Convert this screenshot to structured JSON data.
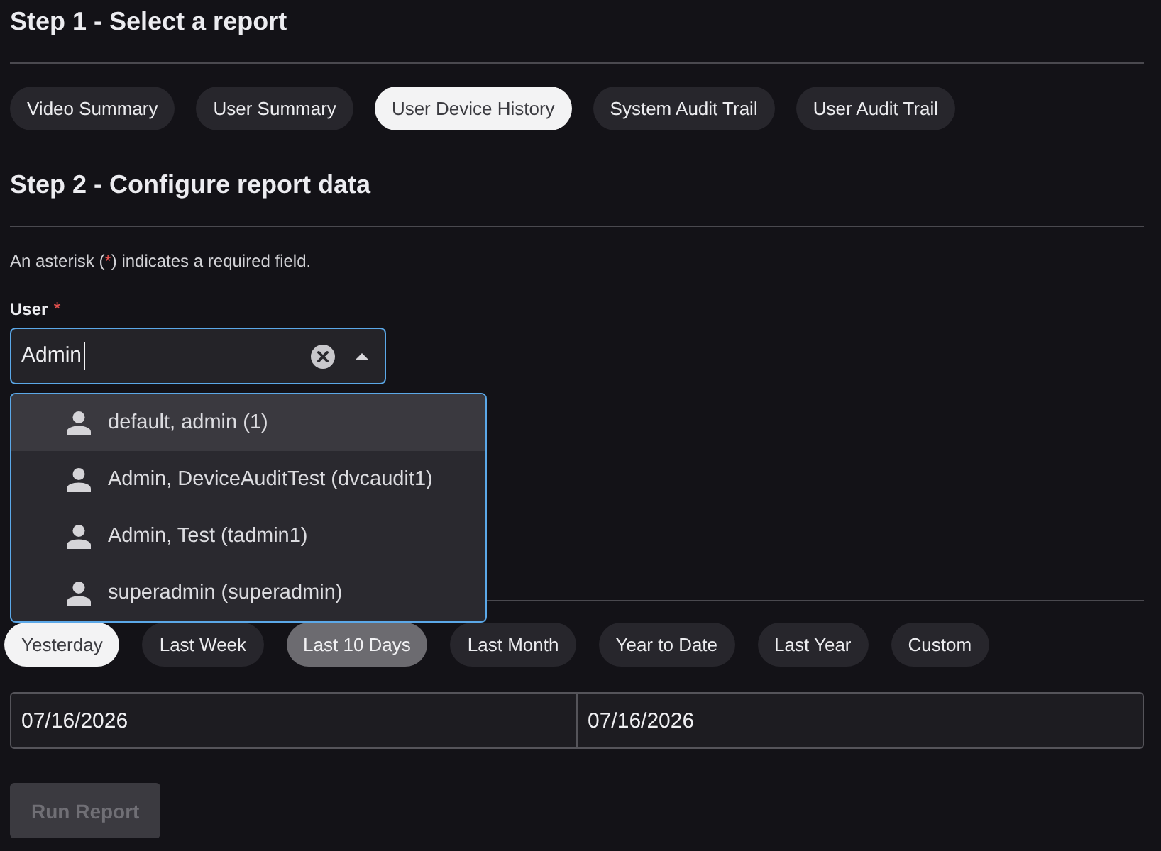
{
  "step1": {
    "heading": "Step 1 - Select a report",
    "reports": [
      {
        "label": "Video Summary",
        "selected": false
      },
      {
        "label": "User Summary",
        "selected": false
      },
      {
        "label": "User Device History",
        "selected": true
      },
      {
        "label": "System Audit Trail",
        "selected": false
      },
      {
        "label": "User Audit Trail",
        "selected": false
      }
    ]
  },
  "step2": {
    "heading": "Step 2 - Configure report data",
    "note": [
      {
        "text": "An asterisk ("
      },
      {
        "text": "*",
        "kind": "required"
      },
      {
        "text": ") indicates a required field."
      }
    ],
    "user_field": {
      "label": "User",
      "required_mark": "*",
      "value": "Admin",
      "focused": true,
      "open": true,
      "options": [
        {
          "label": "default, admin (1)",
          "highlighted": true
        },
        {
          "label": "Admin, DeviceAuditTest (dvcaudit1)",
          "highlighted": false
        },
        {
          "label": "Admin, Test (tadmin1)",
          "highlighted": false
        },
        {
          "label": "superadmin (superadmin)",
          "highlighted": false
        }
      ]
    }
  },
  "date_ranges": [
    {
      "label": "Yesterday",
      "selected": true,
      "hovered": false
    },
    {
      "label": "Last Week",
      "selected": false,
      "hovered": false
    },
    {
      "label": "Last 10 Days",
      "selected": false,
      "hovered": true
    },
    {
      "label": "Last Month",
      "selected": false,
      "hovered": false
    },
    {
      "label": "Year to Date",
      "selected": false,
      "hovered": false
    },
    {
      "label": "Last Year",
      "selected": false,
      "hovered": false
    },
    {
      "label": "Custom",
      "selected": false,
      "hovered": false
    }
  ],
  "date_fields": [
    {
      "value": "07/16/2026"
    },
    {
      "value": "07/16/2026"
    }
  ],
  "run_button": {
    "label": "Run Report",
    "disabled": true
  }
}
